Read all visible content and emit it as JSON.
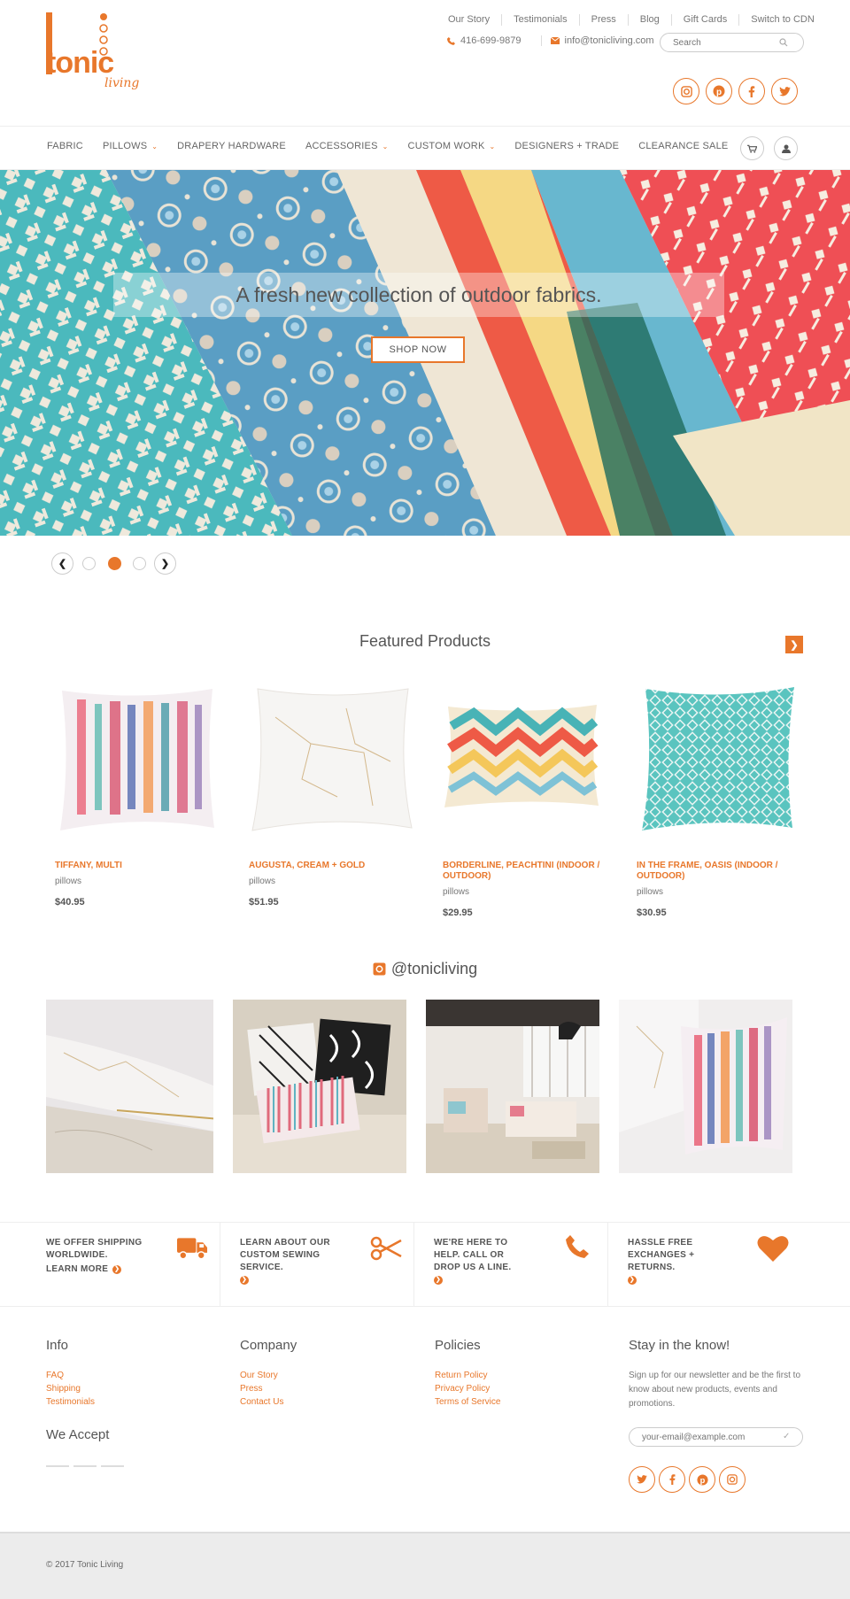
{
  "brand": {
    "logo_main": "tonic",
    "logo_sub": "living",
    "accent": "#e8772b"
  },
  "topnav": [
    "Our Story",
    "Testimonials",
    "Press",
    "Blog",
    "Gift Cards",
    "Switch to CDN"
  ],
  "contact": {
    "phone": "416-699-9879",
    "email": "info@tonicliving.com"
  },
  "search": {
    "placeholder": "Search"
  },
  "social_icons": [
    "instagram-icon",
    "pinterest-icon",
    "facebook-icon",
    "twitter-icon"
  ],
  "mainnav": [
    {
      "label": "FABRIC",
      "dropdown": false
    },
    {
      "label": "PILLOWS",
      "dropdown": true
    },
    {
      "label": "DRAPERY HARDWARE",
      "dropdown": false
    },
    {
      "label": "ACCESSORIES",
      "dropdown": true
    },
    {
      "label": "CUSTOM WORK",
      "dropdown": true
    },
    {
      "label": "DESIGNERS + TRADE",
      "dropdown": false
    },
    {
      "label": "CLEARANCE SALE",
      "dropdown": false
    }
  ],
  "hero": {
    "headline": "A fresh new collection of outdoor fabrics.",
    "button": "SHOP NOW",
    "slide_count": 3,
    "active_slide": 2
  },
  "featured": {
    "title": "Featured Products",
    "products": [
      {
        "name": "TIFFANY, MULTI",
        "category": "pillows",
        "price": "$40.95"
      },
      {
        "name": "AUGUSTA, CREAM + GOLD",
        "category": "pillows",
        "price": "$51.95"
      },
      {
        "name": "BORDERLINE, PEACHTINI (INDOOR / OUTDOOR)",
        "category": "pillows",
        "price": "$29.95"
      },
      {
        "name": "IN THE FRAME, OASIS (INDOOR / OUTDOOR)",
        "category": "pillows",
        "price": "$30.95"
      }
    ]
  },
  "instagram": {
    "handle": "@tonicliving"
  },
  "features": [
    {
      "text": "WE OFFER SHIPPING WORLDWIDE.",
      "link": "LEARN MORE",
      "icon": "truck-icon"
    },
    {
      "text": "LEARN ABOUT OUR CUSTOM SEWING SERVICE.",
      "link": "",
      "icon": "scissors-icon"
    },
    {
      "text": "WE'RE HERE TO HELP. CALL OR DROP US A LINE.",
      "link": "",
      "icon": "phone-icon"
    },
    {
      "text": "HASSLE FREE EXCHANGES + RETURNS.",
      "link": "",
      "icon": "heart-icon"
    }
  ],
  "footer": {
    "info": {
      "title": "Info",
      "links": [
        "FAQ",
        "Shipping",
        "Testimonials"
      ]
    },
    "company": {
      "title": "Company",
      "links": [
        "Our Story",
        "Press",
        "Contact Us"
      ]
    },
    "policies": {
      "title": "Policies",
      "links": [
        "Return Policy",
        "Privacy Policy",
        "Terms of Service"
      ]
    },
    "newsletter": {
      "title": "Stay in the know!",
      "text": "Sign up for our newsletter and be the first to know about new products, events and promotions.",
      "placeholder": "your-email@example.com"
    },
    "accept_title": "We Accept",
    "copyright": "© 2017 Tonic Living"
  }
}
